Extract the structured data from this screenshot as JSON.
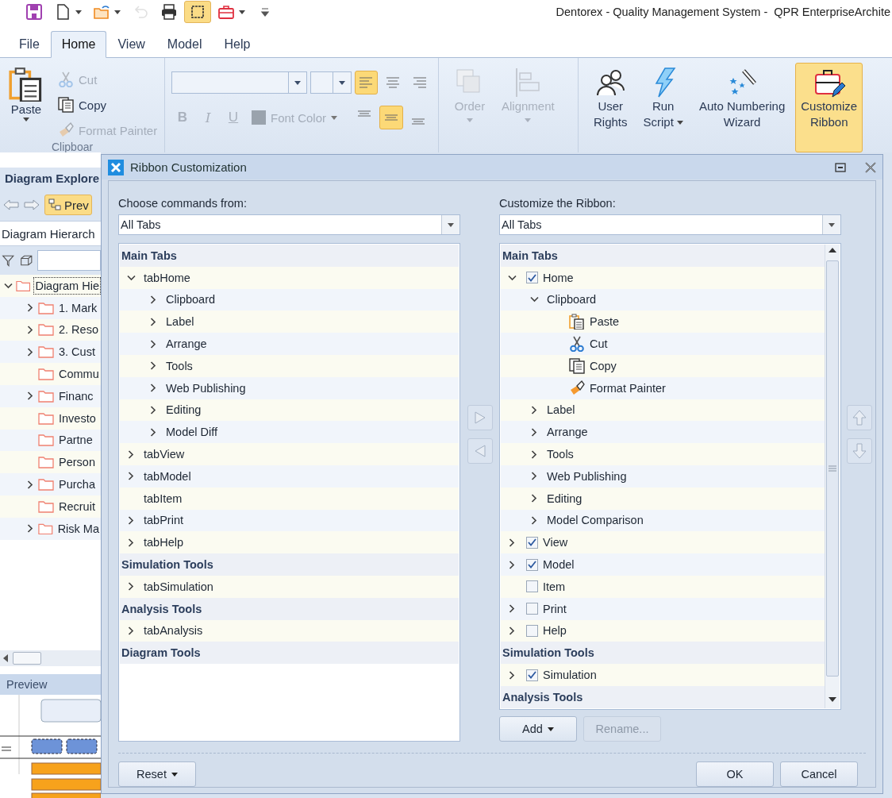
{
  "quick_access": [
    {
      "kind": "save",
      "dropdown": false,
      "disabled": false,
      "selected": false
    },
    {
      "kind": "new",
      "dropdown": true,
      "disabled": false,
      "selected": false
    },
    {
      "kind": "open",
      "dropdown": true,
      "disabled": false,
      "selected": false
    },
    {
      "kind": "undo",
      "dropdown": false,
      "disabled": true,
      "selected": false
    },
    {
      "kind": "print",
      "dropdown": false,
      "disabled": false,
      "selected": false
    },
    {
      "kind": "frame",
      "dropdown": false,
      "disabled": false,
      "selected": true
    },
    {
      "kind": "toolbox",
      "dropdown": true,
      "disabled": false,
      "selected": false
    },
    {
      "kind": "more",
      "dropdown": false,
      "disabled": false,
      "selected": false
    }
  ],
  "window": {
    "title": "Dentorex - Quality Management System -  QPR EnterpriseArchite"
  },
  "tabs": [
    {
      "label": "File",
      "selected": false
    },
    {
      "label": "Home",
      "selected": true
    },
    {
      "label": "View",
      "selected": false
    },
    {
      "label": "Model",
      "selected": false
    },
    {
      "label": "Help",
      "selected": false
    }
  ],
  "ribbon": {
    "clipboard": {
      "label": "Clipboar",
      "paste": {
        "label": "Paste"
      },
      "commands": [
        {
          "label": "Cut",
          "disabled": true
        },
        {
          "label": "Copy",
          "disabled": false
        },
        {
          "label": "Format Painter",
          "disabled": true
        }
      ]
    },
    "font": {
      "align_buttons": [
        {
          "selected": true
        },
        {
          "selected": false
        },
        {
          "selected": false
        }
      ],
      "style_buttons": [
        {
          "label": "B",
          "disabled": true
        },
        {
          "label": "I",
          "disabled": true
        },
        {
          "label": "U",
          "disabled": true
        }
      ],
      "font_color": {
        "label": "Font Color",
        "disabled": true
      },
      "valign_buttons": [
        {
          "selected": false
        },
        {
          "selected": true
        },
        {
          "selected": false
        }
      ]
    },
    "arrange": [
      {
        "lines": [
          "Order"
        ],
        "dropdown": true,
        "disabled": true,
        "selected": false
      },
      {
        "lines": [
          "Alignment"
        ],
        "dropdown": true,
        "disabled": true,
        "selected": false
      }
    ],
    "tools": [
      {
        "lines": [
          "User",
          "Rights"
        ],
        "dropdown": false,
        "disabled": false,
        "selected": false
      },
      {
        "lines": [
          "Run",
          "Script"
        ],
        "dropdown": true,
        "disabled": false,
        "selected": false
      },
      {
        "lines": [
          "Auto Numbering",
          "Wizard"
        ],
        "dropdown": false,
        "disabled": false,
        "selected": false
      },
      {
        "lines": [
          "Customize",
          "Ribbon"
        ],
        "dropdown": false,
        "disabled": false,
        "selected": true
      }
    ]
  },
  "explorer": {
    "title": "Diagram Explore",
    "preview_button": "Prev",
    "hierarchy": "Diagram Hierarch",
    "tree": [
      {
        "label": "Diagram Hie",
        "expandable": true,
        "expanded": true,
        "selected": true,
        "children": [
          {
            "label": "1. Mark",
            "expandable": true,
            "expanded": false,
            "selected": false
          },
          {
            "label": "2. Reso",
            "expandable": true,
            "expanded": false,
            "selected": false
          },
          {
            "label": "3. Cust",
            "expandable": true,
            "expanded": false,
            "selected": false
          },
          {
            "label": "Commu",
            "expandable": false,
            "selected": false
          },
          {
            "label": "Financ",
            "expandable": true,
            "expanded": false,
            "selected": false
          },
          {
            "label": "Investo",
            "expandable": false,
            "selected": false
          },
          {
            "label": "Partne",
            "expandable": false,
            "selected": false
          },
          {
            "label": "Person",
            "expandable": false,
            "selected": false
          },
          {
            "label": "Purcha",
            "expandable": true,
            "expanded": false,
            "selected": false
          },
          {
            "label": "Recruit",
            "expandable": false,
            "selected": false
          },
          {
            "label": "Risk Ma",
            "expandable": true,
            "expanded": false,
            "selected": false
          }
        ]
      }
    ],
    "preview_title": "Preview"
  },
  "dialog": {
    "title": "Ribbon Customization",
    "left": {
      "label": "Choose commands from:",
      "combo": "All Tabs",
      "tree": [
        {
          "kind": "group",
          "label": "Main Tabs",
          "children": [
            {
              "kind": "node",
              "label": "tabHome",
              "expandable": true,
              "expanded": true,
              "children": [
                {
                  "kind": "node",
                  "label": "Clipboard",
                  "expandable": true,
                  "expanded": false
                },
                {
                  "kind": "node",
                  "label": "Label",
                  "expandable": true,
                  "expanded": false
                },
                {
                  "kind": "node",
                  "label": "Arrange",
                  "expandable": true,
                  "expanded": false
                },
                {
                  "kind": "node",
                  "label": "Tools",
                  "expandable": true,
                  "expanded": false
                },
                {
                  "kind": "node",
                  "label": "Web Publishing",
                  "expandable": true,
                  "expanded": false
                },
                {
                  "kind": "node",
                  "label": "Editing",
                  "expandable": true,
                  "expanded": false
                },
                {
                  "kind": "node",
                  "label": "Model Diff",
                  "expandable": true,
                  "expanded": false
                }
              ]
            },
            {
              "kind": "node",
              "label": "tabView",
              "expandable": true,
              "expanded": false
            },
            {
              "kind": "node",
              "label": "tabModel",
              "expandable": true,
              "expanded": false
            },
            {
              "kind": "node",
              "label": "tabItem",
              "expandable": false
            },
            {
              "kind": "node",
              "label": "tabPrint",
              "expandable": true,
              "expanded": false
            },
            {
              "kind": "node",
              "label": "tabHelp",
              "expandable": true,
              "expanded": false
            }
          ]
        },
        {
          "kind": "group",
          "label": "Simulation Tools",
          "children": [
            {
              "kind": "node",
              "label": "tabSimulation",
              "expandable": true,
              "expanded": false
            }
          ]
        },
        {
          "kind": "group",
          "label": "Analysis Tools",
          "children": [
            {
              "kind": "node",
              "label": "tabAnalysis",
              "expandable": true,
              "expanded": false
            }
          ]
        },
        {
          "kind": "group",
          "label": "Diagram Tools"
        }
      ]
    },
    "right": {
      "label": "Customize the Ribbon:",
      "combo": "All Tabs",
      "tree": [
        {
          "kind": "group",
          "label": "Main Tabs",
          "children": [
            {
              "kind": "checkable",
              "label": "Home",
              "checked": true,
              "expandable": true,
              "expanded": true,
              "children": [
                {
                  "kind": "node",
                  "label": "Clipboard",
                  "expandable": true,
                  "expanded": true,
                  "children": [
                    {
                      "kind": "command",
                      "label": "Paste",
                      "expandable": false
                    },
                    {
                      "kind": "command",
                      "label": "Cut",
                      "expandable": false
                    },
                    {
                      "kind": "command",
                      "label": "Copy",
                      "expandable": false
                    },
                    {
                      "kind": "command",
                      "label": "Format Painter",
                      "expandable": false
                    }
                  ]
                },
                {
                  "kind": "node",
                  "label": "Label",
                  "expandable": true,
                  "expanded": false
                },
                {
                  "kind": "node",
                  "label": "Arrange",
                  "expandable": true,
                  "expanded": false
                },
                {
                  "kind": "node",
                  "label": "Tools",
                  "expandable": true,
                  "expanded": false
                },
                {
                  "kind": "node",
                  "label": "Web Publishing",
                  "expandable": true,
                  "expanded": false
                },
                {
                  "kind": "node",
                  "label": "Editing",
                  "expandable": true,
                  "expanded": false
                },
                {
                  "kind": "node",
                  "label": "Model Comparison",
                  "expandable": true,
                  "expanded": false
                }
              ]
            },
            {
              "kind": "checkable",
              "label": "View",
              "checked": true,
              "expandable": true,
              "expanded": false
            },
            {
              "kind": "checkable",
              "label": "Model",
              "checked": true,
              "expandable": true,
              "expanded": false
            },
            {
              "kind": "checkable",
              "label": "Item",
              "checked": false,
              "expandable": false
            },
            {
              "kind": "checkable",
              "label": "Print",
              "checked": false,
              "expandable": true,
              "expanded": false
            },
            {
              "kind": "checkable",
              "label": "Help",
              "checked": false,
              "expandable": true,
              "expanded": false
            }
          ]
        },
        {
          "kind": "group",
          "label": "Simulation Tools",
          "children": [
            {
              "kind": "checkable",
              "label": "Simulation",
              "checked": true,
              "expandable": true,
              "expanded": false
            }
          ]
        },
        {
          "kind": "group",
          "label": "Analysis Tools"
        }
      ],
      "buttons": [
        {
          "label": "Add",
          "dropdown": true,
          "disabled": false
        },
        {
          "label": "Rename...",
          "dropdown": false,
          "disabled": true
        }
      ]
    },
    "footer": {
      "reset": {
        "label": "Reset",
        "dropdown": true
      },
      "buttons": [
        "OK",
        "Cancel"
      ]
    }
  }
}
